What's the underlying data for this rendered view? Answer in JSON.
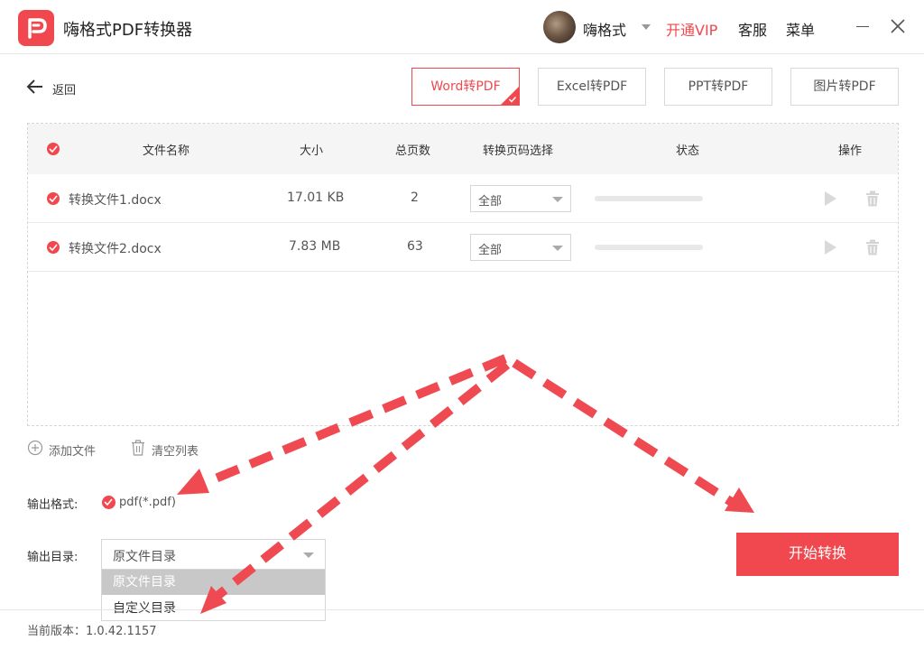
{
  "app": {
    "title": "嗨格式PDF转换器"
  },
  "header": {
    "username": "嗨格式",
    "vip": "开通VIP",
    "service": "客服",
    "menu": "菜单"
  },
  "nav": {
    "back_label": "返回"
  },
  "tabs": [
    {
      "label": "Word转PDF",
      "active": true
    },
    {
      "label": "Excel转PDF",
      "active": false
    },
    {
      "label": "PPT转PDF",
      "active": false
    },
    {
      "label": "图片转PDF",
      "active": false
    }
  ],
  "table": {
    "headers": {
      "name": "文件名称",
      "size": "大小",
      "pages": "总页数",
      "range": "转换页码选择",
      "status": "状态",
      "actions": "操作"
    },
    "rows": [
      {
        "name": "转换文件1.docx",
        "size": "17.01 KB",
        "pages": "2",
        "range": "全部",
        "progress": 0
      },
      {
        "name": "转换文件2.docx",
        "size": "7.83 MB",
        "pages": "63",
        "range": "全部",
        "progress": 0
      }
    ]
  },
  "toolbar": {
    "add_file": "添加文件",
    "clear_list": "清空列表"
  },
  "output": {
    "format_label": "输出格式:",
    "format_value": "pdf(*.pdf)",
    "dir_label": "输出目录:",
    "dir_value": "原文件目录",
    "dir_options": [
      "原文件目录",
      "自定义目录"
    ]
  },
  "actions": {
    "start": "开始转换"
  },
  "footer": {
    "version": "当前版本：1.0.42.1157"
  },
  "colors": {
    "accent": "#f0484e",
    "arrow": "#ef4a52"
  }
}
